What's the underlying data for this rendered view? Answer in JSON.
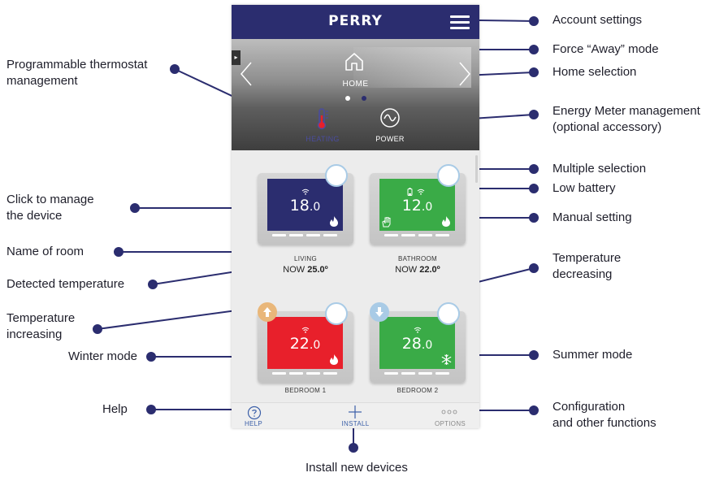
{
  "annotations": {
    "account_settings": "Account settings",
    "force_away": "Force “Away” mode",
    "home_selection": "Home selection",
    "energy_meter": "Energy Meter management\n(optional accessory)",
    "multiple_selection": "Multiple selection",
    "low_battery": "Low battery",
    "manual_setting": "Manual setting",
    "temperature_decreasing": "Temperature\ndecreasing",
    "summer_mode": "Summer mode",
    "configuration": "Configuration\nand other functions",
    "install_new_devices": "Install new devices",
    "programmable_thermostat": "Programmable thermostat\nmanagement",
    "click_to_manage": "Click to manage\nthe device",
    "name_of_room": "Name of room",
    "detected_temperature": "Detected temperature",
    "temperature_increasing": "Temperature\nincreasing",
    "winter_mode": "Winter mode",
    "help": "Help"
  },
  "app": {
    "brand": "PERRY",
    "home_label": "HOME",
    "tabs": [
      {
        "label": "HEATING",
        "color": "#4a4c9e",
        "icon": "thermometer-icon"
      },
      {
        "label": "POWER",
        "color": "#ffffff",
        "icon": "power-meter-icon"
      }
    ],
    "devices": [
      {
        "room": "LIVING",
        "now_prefix": "NOW",
        "now_value": "25.0º",
        "set_int": "18",
        "set_dec": ".0",
        "screen_color": "#2b2d6f",
        "mode_icon": "flame-icon"
      },
      {
        "room": "BATHROOM",
        "now_prefix": "NOW",
        "now_value": "22.0º",
        "set_int": "12",
        "set_dec": ".0",
        "screen_color": "#3aab47",
        "mode_icon": "flame-icon"
      },
      {
        "room": "BEDROOM 1",
        "set_int": "22",
        "set_dec": ".0",
        "screen_color": "#e8202b",
        "mode_icon": "flame-icon"
      },
      {
        "room": "BEDROOM 2",
        "set_int": "28",
        "set_dec": ".0",
        "screen_color": "#3aab47",
        "mode_icon": "snowflake-icon"
      }
    ],
    "nav": [
      {
        "label": "HELP",
        "icon": "help-icon"
      },
      {
        "label": "INSTALL",
        "icon": "plus-icon"
      },
      {
        "label": "OPTIONS",
        "icon": "more-icon"
      }
    ],
    "colors": {
      "navy": "#2b2d6f",
      "annotation_line": "#2b2d6f",
      "nav_blue": "#3b5fa8",
      "increase": "#e9b77a",
      "decrease": "#a9cbe6"
    }
  }
}
